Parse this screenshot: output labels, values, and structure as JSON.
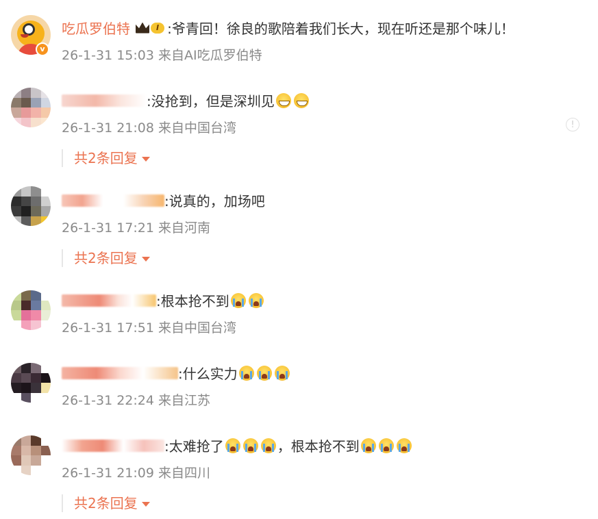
{
  "comments": [
    {
      "username": "吃瓜罗伯特",
      "level": "I",
      "text": ":爷青回！徐良的歌陪着我们长大，现在听还是那个味儿！",
      "emojis": [],
      "date": "26-1-31 15:03",
      "source": "来自AI吃瓜罗伯特",
      "replies": ""
    },
    {
      "username": "",
      "text": ":没抢到，但是深圳见",
      "emojis": [
        "grin-icon",
        "grin-icon"
      ],
      "date": "26-1-31 21:08",
      "source": "来自中国台湾",
      "replies": "共2条回复"
    },
    {
      "username": "",
      "text": ":说真的，加场吧",
      "emojis": [],
      "date": "26-1-31 17:21",
      "source": "来自河南",
      "replies": "共2条回复"
    },
    {
      "username": "",
      "text": ":根本抢不到",
      "emojis": [
        "crying-icon",
        "crying-icon"
      ],
      "date": "26-1-31 17:51",
      "source": "来自中国台湾",
      "replies": ""
    },
    {
      "username": "",
      "text": ":什么实力",
      "emojis": [
        "crying-icon",
        "crying-icon",
        "crying-icon"
      ],
      "date": "26-1-31 22:24",
      "source": "来自江苏",
      "replies": ""
    },
    {
      "username": "",
      "text": ":太难抢了",
      "text2": "，根本抢不到",
      "emojis": [
        "crying-icon",
        "crying-icon",
        "crying-icon"
      ],
      "emojis2": [
        "crying-icon",
        "crying-icon",
        "crying-icon"
      ],
      "date": "26-1-31 21:09",
      "source": "来自四川",
      "replies": "共2条回复"
    }
  ],
  "colors": {
    "username": "#eb7350",
    "meta": "#8a8a8a",
    "text": "#333333",
    "reply_link": "#eb7350"
  }
}
